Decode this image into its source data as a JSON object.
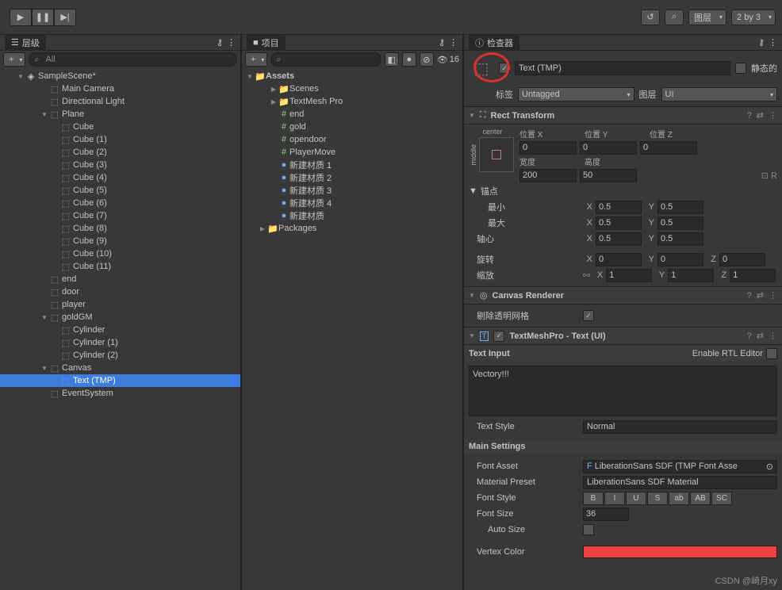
{
  "toolbar": {
    "layers_label": "图层",
    "layout_label": "2 by 3"
  },
  "hierarchy": {
    "title": "层级",
    "search_placeholder": "All",
    "scene": "SampleScene*",
    "items": [
      {
        "name": "Main Camera",
        "depth": 1,
        "fold": ""
      },
      {
        "name": "Directional Light",
        "depth": 1,
        "fold": ""
      },
      {
        "name": "Plane",
        "depth": 1,
        "fold": "▼"
      },
      {
        "name": "Cube",
        "depth": 2,
        "fold": ""
      },
      {
        "name": "Cube (1)",
        "depth": 2,
        "fold": ""
      },
      {
        "name": "Cube (2)",
        "depth": 2,
        "fold": ""
      },
      {
        "name": "Cube (3)",
        "depth": 2,
        "fold": ""
      },
      {
        "name": "Cube (4)",
        "depth": 2,
        "fold": ""
      },
      {
        "name": "Cube (5)",
        "depth": 2,
        "fold": ""
      },
      {
        "name": "Cube (6)",
        "depth": 2,
        "fold": ""
      },
      {
        "name": "Cube (7)",
        "depth": 2,
        "fold": ""
      },
      {
        "name": "Cube (8)",
        "depth": 2,
        "fold": ""
      },
      {
        "name": "Cube (9)",
        "depth": 2,
        "fold": ""
      },
      {
        "name": "Cube (10)",
        "depth": 2,
        "fold": ""
      },
      {
        "name": "Cube (11)",
        "depth": 2,
        "fold": ""
      },
      {
        "name": "end",
        "depth": 1,
        "fold": ""
      },
      {
        "name": "door",
        "depth": 1,
        "fold": ""
      },
      {
        "name": "player",
        "depth": 1,
        "fold": ""
      },
      {
        "name": "goldGM",
        "depth": 1,
        "fold": "▼"
      },
      {
        "name": "Cylinder",
        "depth": 2,
        "fold": ""
      },
      {
        "name": "Cylinder (1)",
        "depth": 2,
        "fold": ""
      },
      {
        "name": "Cylinder (2)",
        "depth": 2,
        "fold": ""
      },
      {
        "name": "Canvas",
        "depth": 1,
        "fold": "▼"
      },
      {
        "name": "Text (TMP)",
        "depth": 2,
        "fold": "",
        "sel": true
      },
      {
        "name": "EventSystem",
        "depth": 1,
        "fold": ""
      }
    ]
  },
  "project": {
    "title": "项目",
    "eye_count": "16",
    "root": "Assets",
    "items": [
      {
        "name": "Scenes",
        "depth": 1,
        "fold": "▶",
        "ico": "folder"
      },
      {
        "name": "TextMesh Pro",
        "depth": 1,
        "fold": "▶",
        "ico": "folder"
      },
      {
        "name": "end",
        "depth": 1,
        "fold": "",
        "ico": "script"
      },
      {
        "name": "gold",
        "depth": 1,
        "fold": "",
        "ico": "script"
      },
      {
        "name": "opendoor",
        "depth": 1,
        "fold": "",
        "ico": "script"
      },
      {
        "name": "PlayerMove",
        "depth": 1,
        "fold": "",
        "ico": "script"
      },
      {
        "name": "新建材质 1",
        "depth": 1,
        "fold": "",
        "ico": "mat"
      },
      {
        "name": "新建材质 2",
        "depth": 1,
        "fold": "",
        "ico": "mat"
      },
      {
        "name": "新建材质 3",
        "depth": 1,
        "fold": "",
        "ico": "mat"
      },
      {
        "name": "新建材质 4",
        "depth": 1,
        "fold": "",
        "ico": "mat"
      },
      {
        "name": "新建材质",
        "depth": 1,
        "fold": "",
        "ico": "mat"
      },
      {
        "name": "Packages",
        "depth": 0,
        "fold": "▶",
        "ico": "folder"
      }
    ]
  },
  "inspector": {
    "title": "检查器",
    "name": "Text (TMP)",
    "static_label": "静态的",
    "tag_label": "标签",
    "tag_value": "Untagged",
    "layer_label": "图层",
    "layer_value": "UI",
    "rect": {
      "title": "Rect Transform",
      "anchor_preset_top": "center",
      "anchor_preset_side": "middle",
      "pos_x_label": "位置 X",
      "pos_y_label": "位置 Y",
      "pos_z_label": "位置 Z",
      "pos_x": "0",
      "pos_y": "0",
      "pos_z": "0",
      "width_label": "宽度",
      "height_label": "高度",
      "width": "200",
      "height": "50",
      "anchors_label": "锚点",
      "min_label": "最小",
      "max_label": "最大",
      "min_x": "0.5",
      "min_y": "0.5",
      "max_x": "0.5",
      "max_y": "0.5",
      "pivot_label": "轴心",
      "pivot_x": "0.5",
      "pivot_y": "0.5",
      "rotation_label": "旋转",
      "rot_x": "0",
      "rot_y": "0",
      "rot_z": "0",
      "scale_label": "缩放",
      "scale_x": "1",
      "scale_y": "1",
      "scale_z": "1"
    },
    "canvas_renderer": {
      "title": "Canvas Renderer",
      "cull_label": "剔除透明网格"
    },
    "tmp": {
      "title": "TextMeshPro - Text (UI)",
      "text_input_label": "Text Input",
      "rtl_label": "Enable RTL Editor",
      "text_value": "Vectory!!!",
      "text_style_label": "Text Style",
      "text_style_value": "Normal",
      "main_settings_label": "Main Settings",
      "font_asset_label": "Font Asset",
      "font_asset_value": "LiberationSans SDF (TMP Font Asse",
      "material_label": "Material Preset",
      "material_value": "LiberationSans SDF Material",
      "font_style_label": "Font Style",
      "style_buttons": [
        "B",
        "I",
        "U",
        "S",
        "ab",
        "AB",
        "SC"
      ],
      "font_size_label": "Font Size",
      "font_size_value": "36",
      "auto_size_label": "Auto Size",
      "vertex_color_label": "Vertex Color"
    }
  },
  "watermark": "CSDN @崎月xy"
}
